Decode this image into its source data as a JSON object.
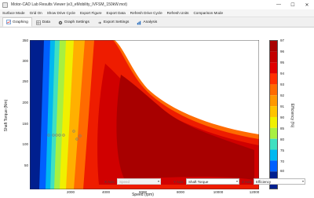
{
  "window": {
    "title": "Motor-CAD Lab Results Viewer (e3_eMobility_IVFSM_150kW.mot)",
    "minimize": "—",
    "maximize": "☐",
    "close": "✕"
  },
  "menu": [
    "Surface Mode",
    "Grid On",
    "Show Drive Cycle",
    "Export Figure",
    "Export Data",
    "Refresh Drive Cycle",
    "Refresh Units",
    "Comparison Mode"
  ],
  "tabs": [
    {
      "label": "Graphing",
      "active": true,
      "icon": "graph-icon"
    },
    {
      "label": "Data",
      "active": false,
      "icon": "data-icon"
    },
    {
      "label": "Graph Settings",
      "active": false,
      "icon": "gear-icon"
    },
    {
      "label": "Export Settings",
      "active": false,
      "icon": "export-icon"
    },
    {
      "label": "Analysis",
      "active": false,
      "icon": "analysis-icon"
    }
  ],
  "plot": {
    "y_axis_label": "Shaft Torque (Nm)",
    "x_axis_label": "Speed (rpm)",
    "y_ticks": [
      "350",
      "300",
      "250",
      "200",
      "150",
      "100",
      "50"
    ],
    "x_ticks": [
      "2000",
      "4000",
      "6000",
      "8000",
      "10000",
      "12000"
    ],
    "colorbar_ticks": [
      "97",
      "96",
      "95",
      "94",
      "93",
      "92",
      "91",
      "90",
      "85",
      "80",
      "75",
      "70",
      "60",
      "50"
    ],
    "colorbar_label": "Efficiency (%)"
  },
  "bottom": {
    "x_axis_label": "X Axis:",
    "x_axis_value": "Speed",
    "y_axis_label": "Y Axis:",
    "y_axis_value": "Shaft Torque",
    "z_axis_label": "Z Axis:",
    "z_axis_value": "Efficiency"
  }
}
